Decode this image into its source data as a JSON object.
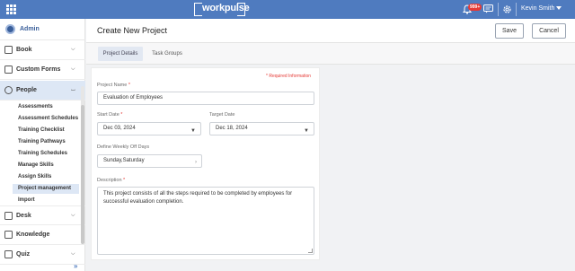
{
  "topbar": {
    "brand": "workpulse",
    "notification_count": "999+",
    "user_name": "Kevin Smith",
    "icons": [
      "apps-grid-icon",
      "bell-icon",
      "chat-icon",
      "gear-icon",
      "chevron-down-icon"
    ]
  },
  "sidebar": {
    "admin_label": "Admin",
    "items": [
      {
        "label": "Book",
        "icon": "book-icon",
        "expanded": false
      },
      {
        "label": "Custom Forms",
        "icon": "form-icon",
        "expanded": false
      },
      {
        "label": "People",
        "icon": "people-icon",
        "expanded": true
      },
      {
        "label": "Desk",
        "icon": "desk-icon",
        "expanded": false
      },
      {
        "label": "Knowledge",
        "icon": "knowledge-icon",
        "expanded": false
      },
      {
        "label": "Quiz",
        "icon": "quiz-icon",
        "expanded": false
      }
    ],
    "people_subitems": [
      "Assessments",
      "Assessment Schedules",
      "Training Checklist",
      "Training Pathways",
      "Training Schedules",
      "Manage Skills",
      "Assign Skills",
      "Project management",
      "Import"
    ],
    "active_subitem": "Project management",
    "collapse_glyph": "»"
  },
  "header": {
    "title": "Create New Project",
    "save_label": "Save",
    "cancel_label": "Cancel"
  },
  "tabs": [
    {
      "label": "Project Details",
      "active": true
    },
    {
      "label": "Task Groups",
      "active": false
    }
  ],
  "form": {
    "required_info": "* Required Information",
    "project_name": {
      "label": "Project Name",
      "value": "Evaluation of Employees"
    },
    "start_date": {
      "label": "Start Date",
      "value": "Dec 03, 2024"
    },
    "target_date": {
      "label": "Target Date",
      "value": "Dec 18, 2024"
    },
    "weekly_off": {
      "label": "Define Weekly Off Days",
      "value": "Sunday,Saturday"
    },
    "description": {
      "label": "Description",
      "value": "This project consists of all the steps required to be completed by employees for successful evaluation completion."
    }
  },
  "colors": {
    "topbar": "#4f7bbf",
    "accent": "#3a5f9a",
    "required": "#e53935",
    "active_bg": "#dde7f5"
  }
}
